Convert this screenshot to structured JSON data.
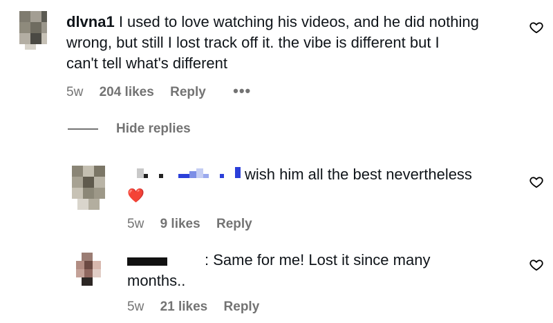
{
  "comments": [
    {
      "username": "dlvna1",
      "text_line1": "I used to love watching his videos, and he did nothing",
      "text_line2": "wrong, but still I lost track off it. the vibe is different but I",
      "text_line3": "can't tell what's different",
      "time": "5w",
      "likes": "204 likes",
      "reply": "Reply",
      "more": "•••"
    }
  ],
  "thread": {
    "hide_replies": "Hide replies"
  },
  "replies": [
    {
      "text": "wish him all the best nevertheless",
      "emoji": "❤️",
      "time": "5w",
      "likes": "9 likes",
      "reply": "Reply"
    },
    {
      "text_line1": ": Same for me! Lost it since many",
      "text_line2": "months..",
      "time": "5w",
      "likes": "21 likes",
      "reply": "Reply"
    }
  ],
  "icons": {
    "like": "heart-outline-icon"
  },
  "colors": {
    "meta": "#737373",
    "text": "#0f1419",
    "heart": "#e0245e"
  }
}
